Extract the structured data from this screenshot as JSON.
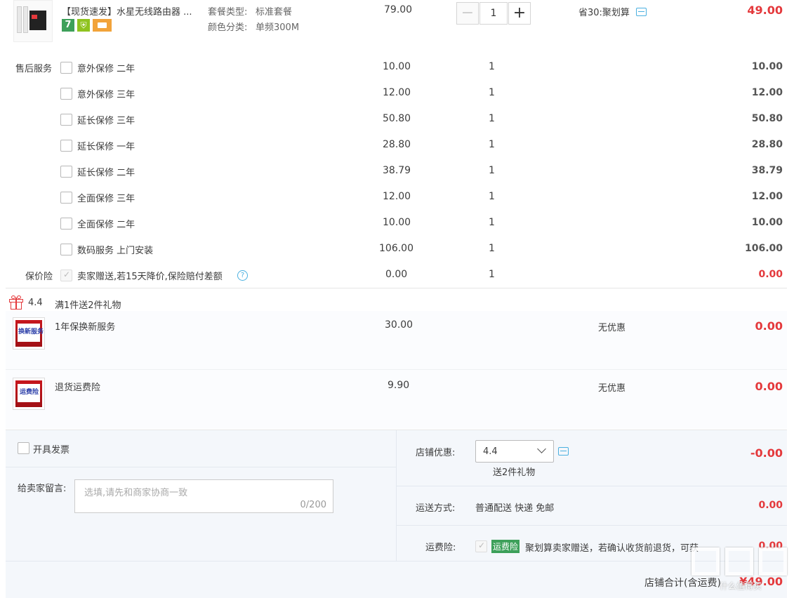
{
  "product": {
    "title": "【现货速发】水星无线路由器 ...",
    "spec_labels": [
      "套餐类型:",
      "颜色分类:"
    ],
    "spec_values": [
      "标准套餐",
      "单频300M"
    ],
    "unit_price": "79.00",
    "quantity": "1",
    "discount_text": "省30:聚划算",
    "total": "49.00",
    "badge_7": "7"
  },
  "services": {
    "section_label": "售后服务",
    "items": [
      {
        "name": "意外保修 二年",
        "price": "10.00",
        "qty": "1",
        "total": "10.00"
      },
      {
        "name": "意外保修 三年",
        "price": "12.00",
        "qty": "1",
        "total": "12.00"
      },
      {
        "name": "延长保修 三年",
        "price": "50.80",
        "qty": "1",
        "total": "50.80"
      },
      {
        "name": "延长保修 一年",
        "price": "28.80",
        "qty": "1",
        "total": "28.80"
      },
      {
        "name": "延长保修 二年",
        "price": "38.79",
        "qty": "1",
        "total": "38.79"
      },
      {
        "name": "全面保修 三年",
        "price": "12.00",
        "qty": "1",
        "total": "12.00"
      },
      {
        "name": "全面保修 二年",
        "price": "10.00",
        "qty": "1",
        "total": "10.00"
      },
      {
        "name": "数码服务 上门安装",
        "price": "106.00",
        "qty": "1",
        "total": "106.00"
      }
    ],
    "price_protect": {
      "label": "保价险",
      "name": "卖家赠送,若15天降价,保险赔付差额",
      "price": "0.00",
      "qty": "1",
      "total": "0.00"
    }
  },
  "gift_section": {
    "promo_code": "4.4",
    "promo_text": "满1件送2件礼物",
    "gifts": [
      {
        "name": "1年保换新服务",
        "price": "30.00",
        "discount": "无优惠",
        "total": "0.00",
        "thumb_text": "换新服务"
      },
      {
        "name": "退货运费险",
        "price": "9.90",
        "discount": "无优惠",
        "total": "0.00",
        "thumb_text": "运费险"
      }
    ]
  },
  "invoice": {
    "label": "开具发票"
  },
  "note": {
    "label": "给卖家留言:",
    "placeholder": "选填,请先和商家协商一致",
    "counter": "0/200"
  },
  "shop_discount": {
    "label": "店铺优惠:",
    "selected": "4.4",
    "sub": "送2件礼物",
    "amount": "-0.00"
  },
  "shipping": {
    "label": "运送方式:",
    "value": "普通配送 快递 免邮",
    "amount": "0.00"
  },
  "freight_insurance": {
    "label": "运费险:",
    "tag": "运费险",
    "text": "聚划算卖家赠送，若确认收货前退货，可获",
    "amount": "0.00"
  },
  "summary": {
    "label": "店铺合计(含运费)",
    "amount": "¥49.00"
  },
  "watermark": {
    "text": "什么值得买"
  },
  "colors": {
    "red": "#e4393c",
    "green": "#3da05a",
    "bottom_bg": "#f4f7fb"
  }
}
